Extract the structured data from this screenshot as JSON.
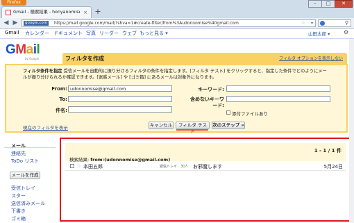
{
  "browser": {
    "app_button": "Firefox",
    "tab_title": "Gmail - 検索結果 - honyanomise@gmail.c...",
    "url_site": "google.com",
    "url": "https://mail.google.com/mail/?shva=1#create-filter/from%3Audonnomise%40gmail.com",
    "win_min": "–",
    "win_max": "□",
    "win_close": "✕"
  },
  "gbar": {
    "links": [
      "Gmail",
      "カレンダー",
      "ドキュメント",
      "写真",
      "リーダー",
      "ウェブ",
      "もっと見る ▾"
    ],
    "user": "山田太郎 ▾"
  },
  "logo": {
    "by": "by Google"
  },
  "filter": {
    "title": "フィルタを作成",
    "options_link": "フィルタ オプションを表示しない",
    "desc_label": "フィルタ条件を指定",
    "desc_text": " 受信メールを自動的に振り分けるフィルタの条件を指定します。[フィルタ テスト] をクリックすると、指定した条件でどのようにメールが振り分けられるか確認できます。[迷惑メール] や [ゴミ箱] にあるメールは対象外になります。",
    "from_label": "From:",
    "from_value": "udonnomise@gmail.com",
    "to_label": "To:",
    "to_value": "",
    "subject_label": "件名:",
    "subject_value": "",
    "keyword_label": "キーワード:",
    "keyword_value": "",
    "exclude_label": "含めないキーワード:",
    "exclude_value": "",
    "attach_label": "添付ファイルあり",
    "current_filters": "現在のフィルタを表示",
    "cancel": "キャンセル",
    "test": "フィルタ テスト",
    "next": "次のステップ »"
  },
  "sidebar": {
    "items_top": [
      "メール",
      "連絡先",
      "ToDo リスト"
    ],
    "compose": "メールを作成",
    "items_bottom": [
      "受信トレイ",
      "スター",
      "送信済みメール",
      "下書き",
      "ゴミ箱"
    ]
  },
  "results": {
    "count": "1 - 1 / 1 件",
    "query_label": "検索結果:",
    "query": "from:(udonnomise@gmail.com)",
    "rows": [
      {
        "from": "本田五郎",
        "label1": "受信トレイ",
        "label2": "知人",
        "subject": "お邪魔します",
        "date": "5月24日"
      }
    ]
  }
}
